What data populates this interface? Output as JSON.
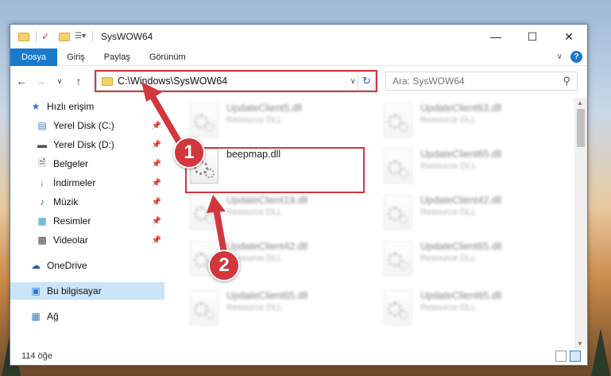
{
  "window": {
    "title": "SysWOW64"
  },
  "ribbon": {
    "tabs": [
      {
        "label": "Dosya"
      },
      {
        "label": "Giriş"
      },
      {
        "label": "Paylaş"
      },
      {
        "label": "Görünüm"
      }
    ]
  },
  "navigation": {
    "address_path": "C:\\Windows\\SysWOW64",
    "search_placeholder": "Ara: SysWOW64"
  },
  "sidebar": {
    "items": [
      {
        "label": "Hızlı erişim",
        "icon": "star-icon",
        "pinned": false
      },
      {
        "label": "Yerel Disk (C:)",
        "icon": "disk-icon",
        "pinned": true
      },
      {
        "label": "Yerel Disk (D:)",
        "icon": "disk-icon",
        "pinned": true
      },
      {
        "label": "Belgeler",
        "icon": "documents-icon",
        "pinned": true
      },
      {
        "label": "İndirmeler",
        "icon": "download-icon",
        "pinned": true
      },
      {
        "label": "Müzik",
        "icon": "music-icon",
        "pinned": true
      },
      {
        "label": "Resimler",
        "icon": "pictures-icon",
        "pinned": true
      },
      {
        "label": "Videolar",
        "icon": "videos-icon",
        "pinned": true
      },
      {
        "label": "OneDrive",
        "icon": "cloud-icon",
        "pinned": false
      },
      {
        "label": "Bu bilgisayar",
        "icon": "computer-icon",
        "pinned": false,
        "selected": true
      },
      {
        "label": "Ağ",
        "icon": "network-icon",
        "pinned": false
      }
    ]
  },
  "files": [
    {
      "name": "UpdateClient5.dll",
      "type": "Resource DLL",
      "blurred": true
    },
    {
      "name": "UpdateClient63.dll",
      "type": "Resource DLL",
      "blurred": true
    },
    {
      "name": "beepmap.dll",
      "type": "",
      "blurred": false
    },
    {
      "name": "UpdateClient65.dll",
      "type": "Resource DLL",
      "blurred": true
    },
    {
      "name": "UpdateClient19.dll",
      "type": "Resource DLL",
      "blurred": true
    },
    {
      "name": "UpdateClient42.dll",
      "type": "Resource DLL",
      "blurred": true
    },
    {
      "name": "UpdateClient42.dll",
      "type": "Resource DLL",
      "blurred": true
    },
    {
      "name": "UpdateClient65.dll",
      "type": "Resource DLL",
      "blurred": true
    },
    {
      "name": "UpdateClient65.dll",
      "type": "Resource DLL",
      "blurred": true
    },
    {
      "name": "UpdateClient65.dll",
      "type": "Resource DLL",
      "blurred": true
    }
  ],
  "status": {
    "item_count": "114 öğe"
  },
  "annotations": {
    "step1": "1",
    "step2": "2",
    "color": "#d2373c"
  }
}
